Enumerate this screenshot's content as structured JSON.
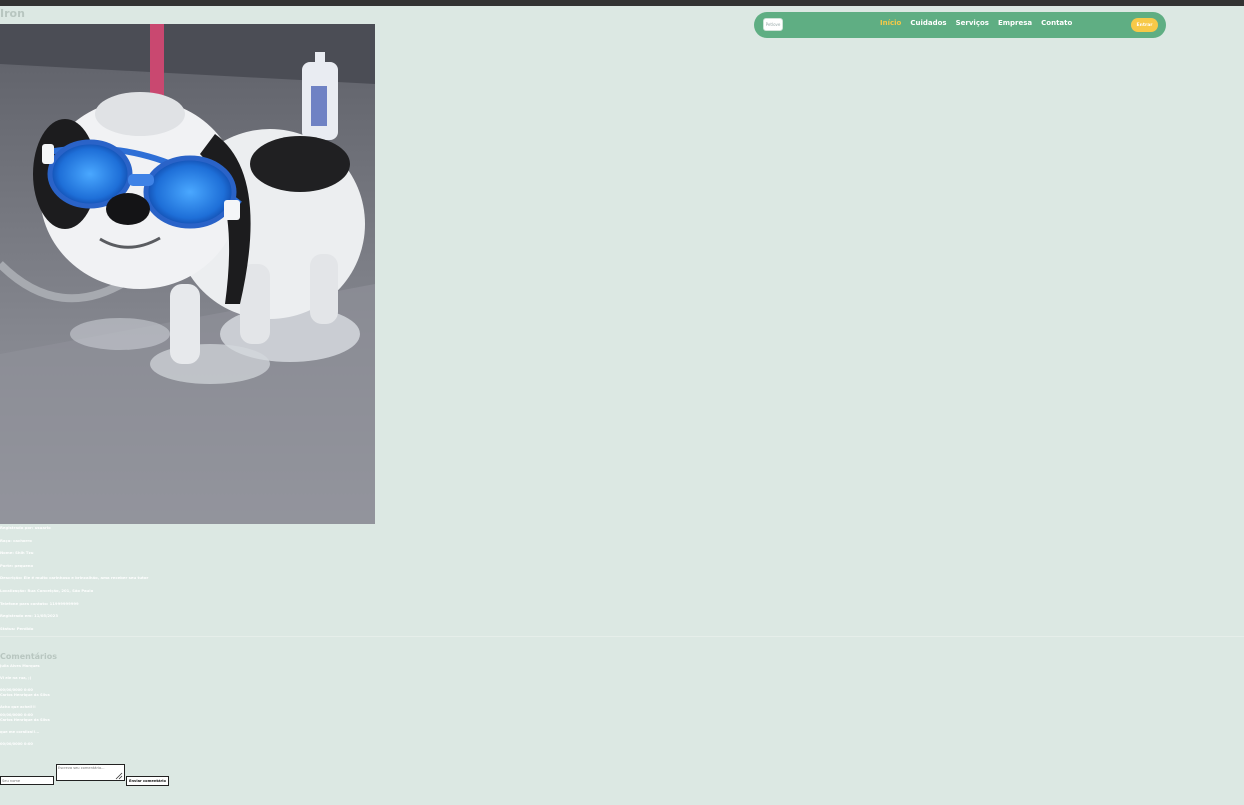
{
  "page": {
    "title": "Iron"
  },
  "navbar": {
    "logo_text": "Petlove",
    "links": [
      "Início",
      "Cuidados",
      "Serviços",
      "Empresa",
      "Contato"
    ],
    "active_link": "Início",
    "cta_label": "Entrar",
    "colors": {
      "bar": "#5fae83",
      "active": "#f7c948",
      "button": "#f7c948"
    }
  },
  "photo": {
    "subject": "wet dog wearing blue swim goggles in a bath tub"
  },
  "info_lines": [
    "Registrado por: usuario",
    "Raça: cachorro",
    "Nome: Shih Tzu",
    "Porte: pequeno",
    "Descrição: Ele é muito carinhoso e brincalhão, ama receber seu tutor",
    "Localização: Rua Conceição, 201, São Paulo",
    "Telefone para contato: 11999999999",
    "Registrado em: 11/05/2023",
    "Status: Perdido"
  ],
  "comments": {
    "title": "Comentários",
    "lines": [
      "Julia Alves Marques",
      "Vi ele na rua, ;)",
      "00/00/0000 0:00",
      "Carlos Henrique da Silva",
      "Acho que achei!!!",
      "00/00/0000 0:00",
      "Carlos Henrique da Silva",
      "que me coraliza!!...",
      "00/00/0000 0:00"
    ]
  },
  "form": {
    "name_placeholder": "Seu nome",
    "comment_placeholder": "Escreva seu comentário...",
    "submit_label": "Enviar comentário"
  },
  "colors": {
    "background": "#dce8e3",
    "top_strip": "#333333",
    "title": "#b8c6c0"
  }
}
